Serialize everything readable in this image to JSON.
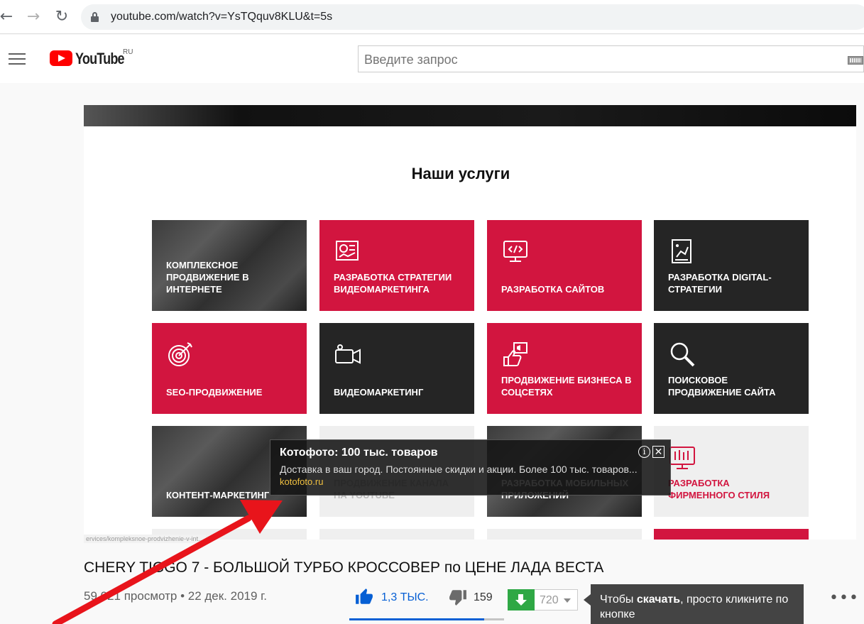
{
  "browser": {
    "back": "←",
    "forward": "→",
    "reload": "↻",
    "url": "youtube.com/watch?v=YsTQquv8KLU&t=5s"
  },
  "header": {
    "logo_text": "YouTube",
    "region": "RU",
    "search_placeholder": "Введите запрос"
  },
  "video": {
    "section_title": "Наши услуги",
    "services": [
      {
        "label": "Комплексное продвижение в интернете",
        "style": "photo",
        "icon": "none"
      },
      {
        "label": "Разработка стратегии видеомаркетинга",
        "style": "red",
        "icon": "chart-icon"
      },
      {
        "label": "Разработка сайтов",
        "style": "red",
        "icon": "code-monitor-icon"
      },
      {
        "label": "Разработка digital-стратегии",
        "style": "dark",
        "icon": "strategy-icon"
      },
      {
        "label": "SEO-продвижение",
        "style": "red",
        "icon": "target-icon"
      },
      {
        "label": "Видеомаркетинг",
        "style": "dark",
        "icon": "video-camera-icon"
      },
      {
        "label": "Продвижение бизнеса в соцсетях",
        "style": "red",
        "icon": "megaphone-icon"
      },
      {
        "label": "Поисковое продвижение сайта",
        "style": "dark",
        "icon": "magnifier-icon"
      },
      {
        "label": "Контент-маркетинг",
        "style": "photo",
        "icon": "none"
      },
      {
        "label": "Продвижение канала на YouTube",
        "style": "light",
        "icon": "none"
      },
      {
        "label": "Разработка мобильных приложений",
        "style": "photo",
        "icon": "none"
      },
      {
        "label": "Разработка фирменного стиля",
        "style": "light",
        "icon": "brand-icon"
      }
    ],
    "status_url": "ervices/kompleksnoe-prodvizhenie-v-int..."
  },
  "ad": {
    "title": "Котофото: 100 тыс. товаров",
    "description": "Доставка в ваш город. Постоянные скидки и акции. Более 100 тыс. товаров...",
    "url": "kotofoto.ru",
    "info": "i",
    "close": "✕"
  },
  "info": {
    "title": "CHERY TIGGO 7 - БОЛЬШОЙ ТУРБО КРОССОВЕР по ЦЕНЕ ЛАДА ВЕСТА",
    "views": "59 021 просмотр • 22 дек. 2019 г.",
    "likes": "1,3 ТЫС.",
    "dislikes": "159",
    "like_ratio": 0.87,
    "downloads": "720"
  },
  "tooltip": {
    "prefix": "Чтобы ",
    "bold": "скачать",
    "suffix": ", просто кликните по кнопке"
  },
  "colors": {
    "red_tile": "#d2153f",
    "dark_tile": "#252525",
    "like_blue": "#065fd4",
    "download_green": "#2fa845",
    "arrow_red": "#e8141b"
  }
}
